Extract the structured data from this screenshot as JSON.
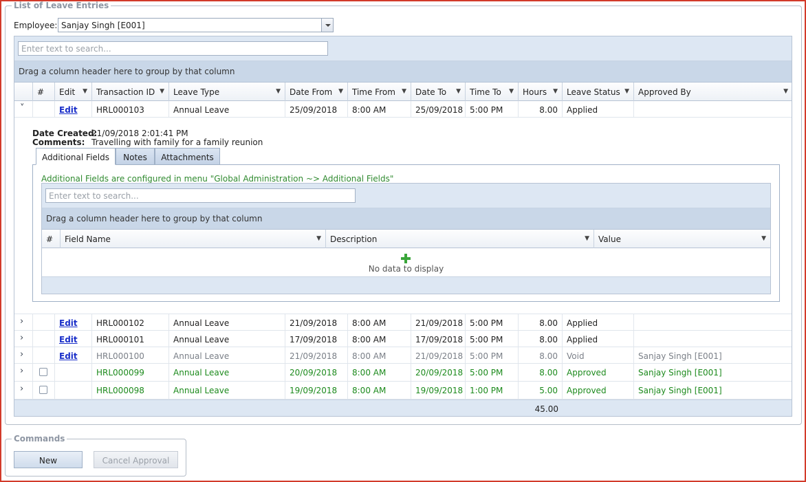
{
  "list_group": {
    "title": "List of Leave Entries",
    "employee_label": "Employee:",
    "employee_value": "Sanjay Singh [E001]",
    "search_placeholder": "Enter text to search...",
    "group_hint": "Drag a column header here to group by that column",
    "columns": {
      "num": "#",
      "edit": "Edit",
      "txn": "Transaction ID",
      "type": "Leave Type",
      "date_from": "Date From",
      "time_from": "Time From",
      "date_to": "Date To",
      "time_to": "Time To",
      "hours": "Hours",
      "status": "Leave Status",
      "approved_by": "Approved By"
    },
    "rows": [
      {
        "edit": "Edit",
        "txn": "HRL000103",
        "type": "Annual Leave",
        "date_from": "25/09/2018",
        "time_from": "8:00 AM",
        "date_to": "25/09/2018",
        "time_to": "5:00 PM",
        "hours": "8.00",
        "status": "Applied",
        "approved_by": ""
      },
      {
        "edit": "Edit",
        "txn": "HRL000102",
        "type": "Annual Leave",
        "date_from": "21/09/2018",
        "time_from": "8:00 AM",
        "date_to": "21/09/2018",
        "time_to": "5:00 PM",
        "hours": "8.00",
        "status": "Applied",
        "approved_by": ""
      },
      {
        "edit": "Edit",
        "txn": "HRL000101",
        "type": "Annual Leave",
        "date_from": "17/09/2018",
        "time_from": "8:00 AM",
        "date_to": "17/09/2018",
        "time_to": "5:00 PM",
        "hours": "8.00",
        "status": "Applied",
        "approved_by": ""
      },
      {
        "edit": "Edit",
        "txn": "HRL000100",
        "type": "Annual Leave",
        "date_from": "21/09/2018",
        "time_from": "8:00 AM",
        "date_to": "21/09/2018",
        "time_to": "5:00 PM",
        "hours": "8.00",
        "status": "Void",
        "approved_by": "Sanjay Singh [E001]"
      },
      {
        "edit": "",
        "txn": "HRL000099",
        "type": "Annual Leave",
        "date_from": "20/09/2018",
        "time_from": "8:00 AM",
        "date_to": "20/09/2018",
        "time_to": "5:00 PM",
        "hours": "8.00",
        "status": "Approved",
        "approved_by": "Sanjay Singh [E001]"
      },
      {
        "edit": "",
        "txn": "HRL000098",
        "type": "Annual Leave",
        "date_from": "19/09/2018",
        "time_from": "8:00 AM",
        "date_to": "19/09/2018",
        "time_to": "1:00 PM",
        "hours": "5.00",
        "status": "Approved",
        "approved_by": "Sanjay Singh [E001]"
      }
    ],
    "total_hours": "45.00"
  },
  "detail": {
    "date_created_label": "Date Created:",
    "date_created_value": "21/09/2018 2:01:41 PM",
    "comments_label": "Comments:",
    "comments_value": "Travelling with family for a family reunion",
    "tabs": [
      "Additional Fields",
      "Notes",
      "Attachments"
    ],
    "info_text": "Additional Fields are configured in menu \"Global Administration ~> Additional Fields\"",
    "search_placeholder": "Enter text to search...",
    "group_hint": "Drag a column header here to group by that column",
    "columns": {
      "num": "#",
      "field_name": "Field Name",
      "description": "Description",
      "value": "Value"
    },
    "empty_text": "No data to display"
  },
  "commands": {
    "title": "Commands",
    "new_label": "New",
    "cancel_approval_label": "Cancel Approval"
  },
  "colors": {
    "frame": "#d23a2a",
    "link": "#1a2fc9",
    "approved": "#1c8a1c",
    "void": "#7a7f87"
  }
}
